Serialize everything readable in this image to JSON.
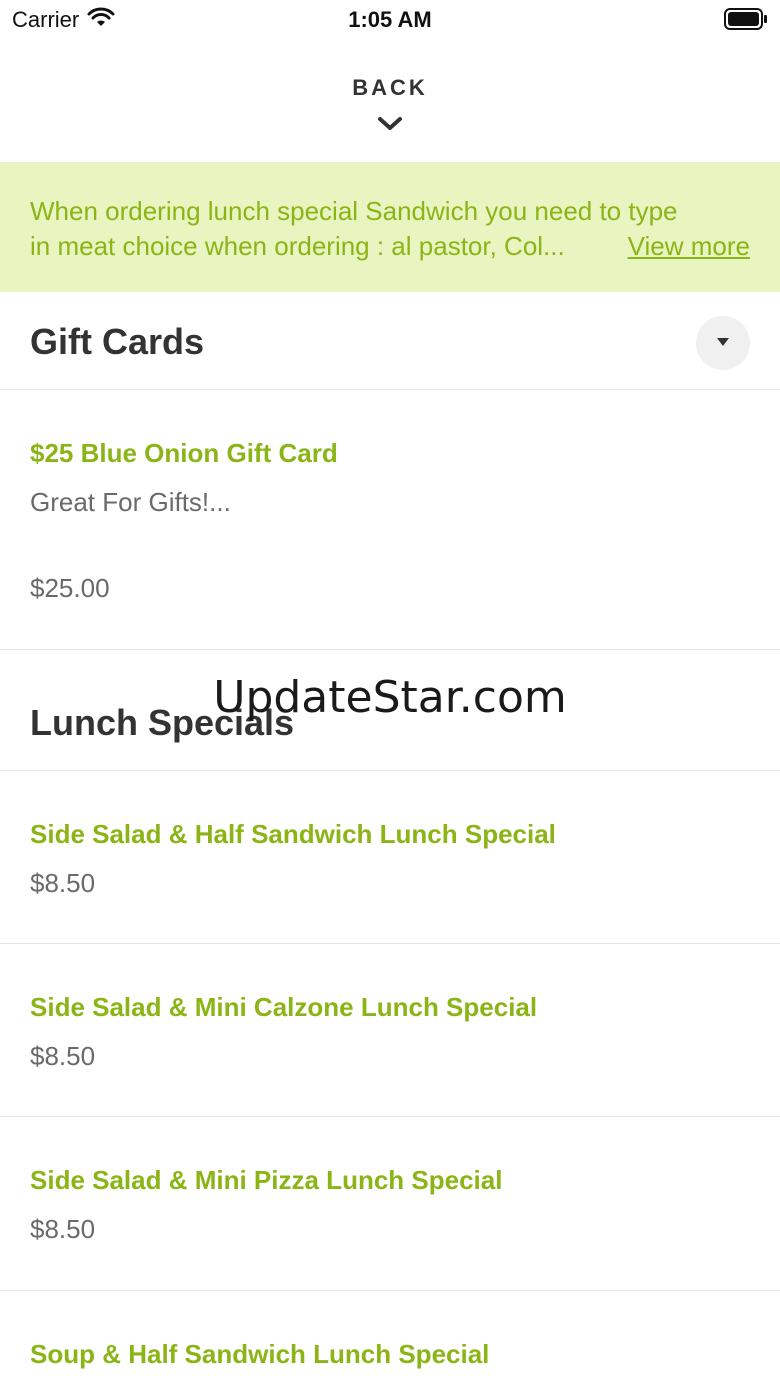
{
  "status_bar": {
    "carrier": "Carrier",
    "time": "1:05 AM"
  },
  "header": {
    "back_label": "BACK"
  },
  "notice": {
    "line1": "When ordering lunch special Sandwich you need to type",
    "line2": "in meat choice when ordering : al pastor, Col...",
    "view_more": "View more"
  },
  "sections": [
    {
      "title": "Gift Cards",
      "items": [
        {
          "name": "$25 Blue Onion Gift Card",
          "description": "Great For Gifts!...",
          "price": "$25.00"
        }
      ]
    },
    {
      "title": "Lunch Specials",
      "items": [
        {
          "name": "Side Salad & Half Sandwich Lunch Special",
          "price": "$8.50"
        },
        {
          "name": "Side Salad & Mini Calzone Lunch Special",
          "price": "$8.50"
        },
        {
          "name": "Side Salad & Mini Pizza Lunch Special",
          "price": "$8.50"
        },
        {
          "name": "Soup & Half Sandwich Lunch Special",
          "price": ""
        }
      ]
    }
  ],
  "watermark": "UpdateStar.com",
  "colors": {
    "accent": "#8bb516",
    "notice_bg": "#e8f5c0",
    "divider": "#e4e4e4",
    "muted_text": "#6a6a6a"
  },
  "icons": {
    "wifi": "wifi-icon",
    "battery": "battery-icon",
    "back": "chevron-down-icon",
    "dropdown": "caret-down-icon"
  }
}
